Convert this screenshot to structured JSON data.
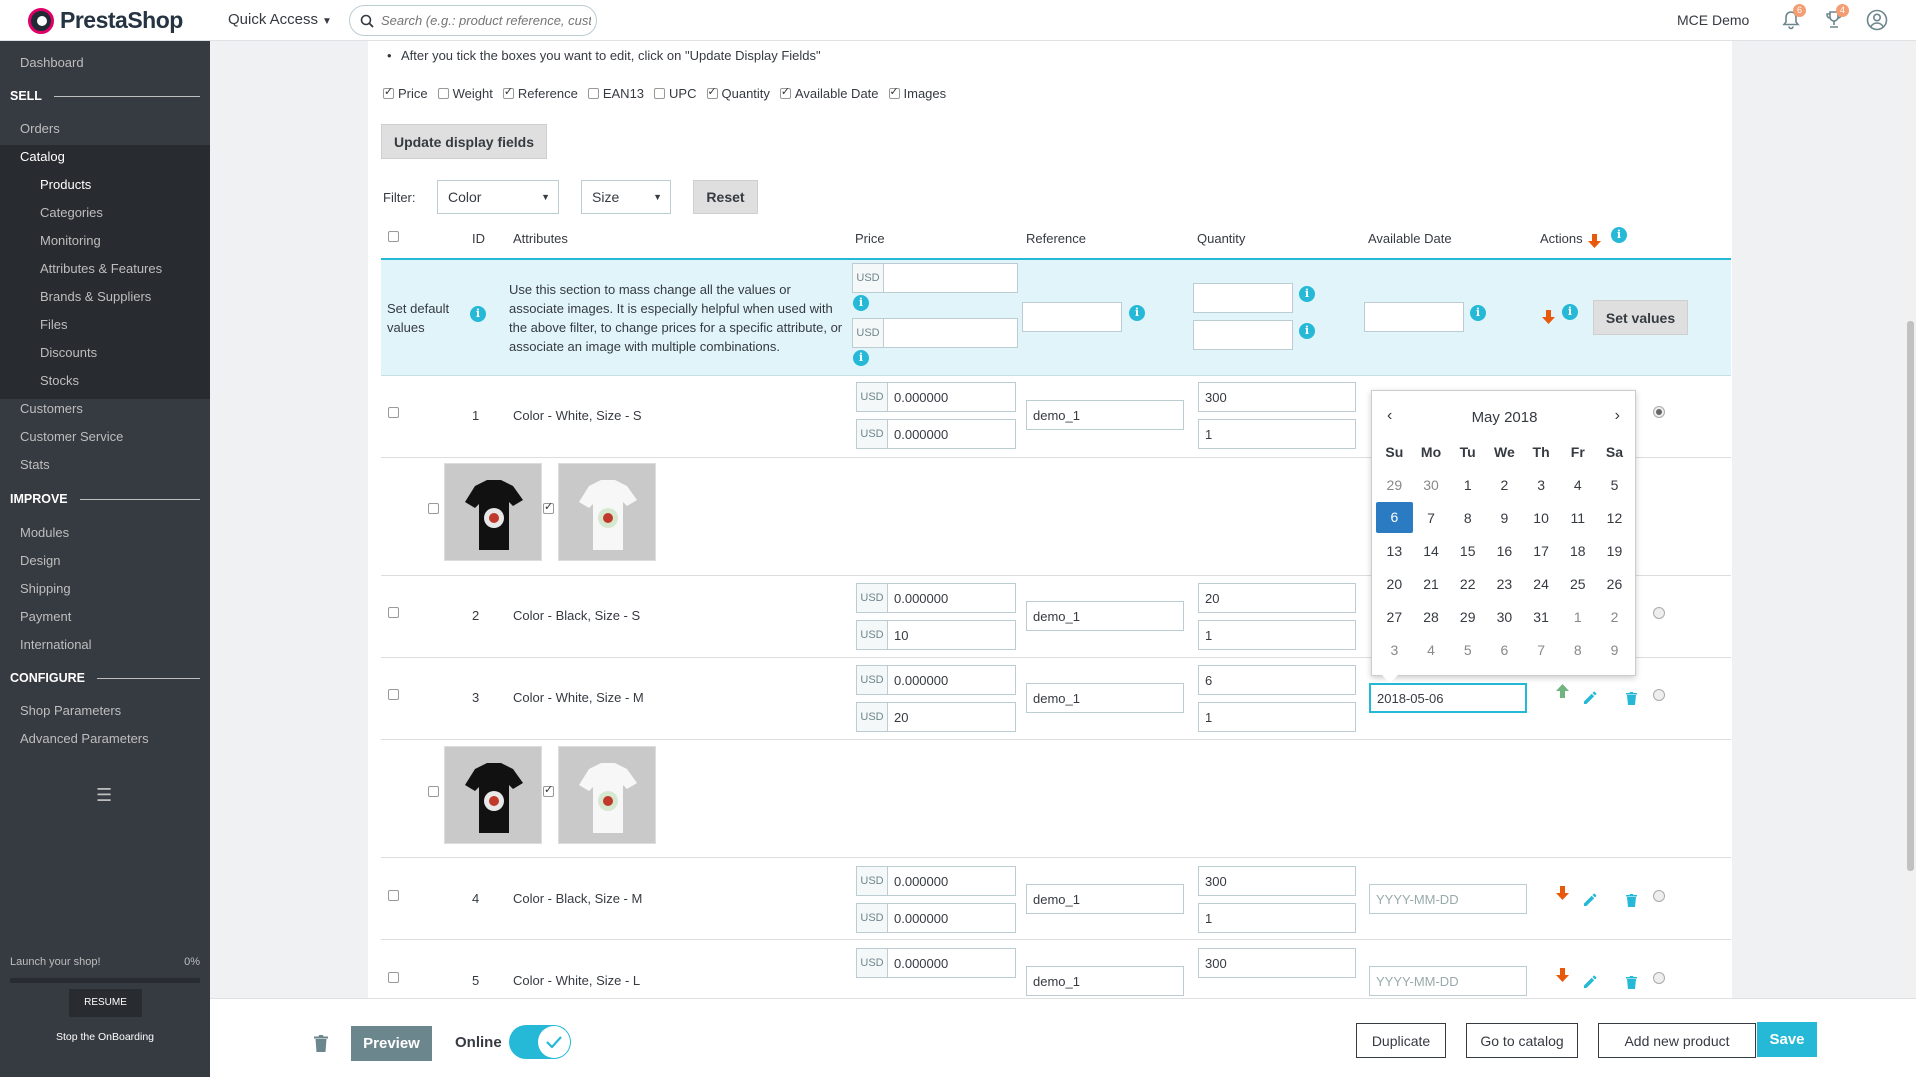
{
  "header": {
    "logo_text": "PrestaShop",
    "quick_access": "Quick Access",
    "search_placeholder": "Search (e.g.: product reference, custo",
    "shop_name": "MCE Demo",
    "notif_orders": "6",
    "notif_customers": "4"
  },
  "sidebar": {
    "dashboard": "Dashboard",
    "sell": "SELL",
    "orders": "Orders",
    "catalog": "Catalog",
    "catalog_items": [
      "Products",
      "Categories",
      "Monitoring",
      "Attributes & Features",
      "Brands & Suppliers",
      "Files",
      "Discounts",
      "Stocks"
    ],
    "customers": "Customers",
    "customer_service": "Customer Service",
    "stats": "Stats",
    "improve": "IMPROVE",
    "improve_items": [
      "Modules",
      "Design",
      "Shipping",
      "Payment",
      "International"
    ],
    "configure": "CONFIGURE",
    "configure_items": [
      "Shop Parameters",
      "Advanced Parameters"
    ],
    "launch": "Launch your shop!",
    "launch_pct": "0%",
    "resume": "RESUME",
    "stop": "Stop the OnBoarding"
  },
  "content": {
    "note": "After you tick the boxes you want to edit, click on \"Update Display Fields\"",
    "fields": [
      {
        "label": "Price",
        "checked": true
      },
      {
        "label": "Weight",
        "checked": false
      },
      {
        "label": "Reference",
        "checked": true
      },
      {
        "label": "EAN13",
        "checked": false
      },
      {
        "label": "UPC",
        "checked": false
      },
      {
        "label": "Quantity",
        "checked": true
      },
      {
        "label": "Available Date",
        "checked": true
      },
      {
        "label": "Images",
        "checked": true
      }
    ],
    "update_btn": "Update display fields",
    "filter_label": "Filter:",
    "filter_color": "Color",
    "filter_size": "Size",
    "reset_btn": "Reset",
    "columns": {
      "id": "ID",
      "attributes": "Attributes",
      "price": "Price",
      "reference": "Reference",
      "quantity": "Quantity",
      "available_date": "Available Date",
      "actions": "Actions"
    },
    "defaults": {
      "label": "Set default values",
      "help": "Use this section to mass change all the values or associate images. It is especially helpful when used with the above filter, to change prices for a specific attribute, or associate an image with multiple combinations.",
      "currency": "USD",
      "set_values": "Set values"
    },
    "rows": [
      {
        "id": "1",
        "attr": "Color - White, Size - S",
        "price1": "0.000000",
        "price2": "0.000000",
        "ref": "demo_1",
        "qty1": "300",
        "qty2": "1",
        "date": ""
      },
      {
        "id": "2",
        "attr": "Color - Black, Size - S",
        "price1": "0.000000",
        "price2": "10",
        "ref": "demo_1",
        "qty1": "20",
        "qty2": "1",
        "date": ""
      },
      {
        "id": "3",
        "attr": "Color - White, Size - M",
        "price1": "0.000000",
        "price2": "20",
        "ref": "demo_1",
        "qty1": "6",
        "qty2": "1",
        "date": "2018-05-06"
      },
      {
        "id": "4",
        "attr": "Color - Black, Size - M",
        "price1": "0.000000",
        "price2": "0.000000",
        "ref": "demo_1",
        "qty1": "300",
        "qty2": "1",
        "date": ""
      },
      {
        "id": "5",
        "attr": "Color - White, Size - L",
        "price1": "0.000000",
        "price2": "0.000000",
        "ref": "demo_1",
        "qty1": "300",
        "qty2": "1",
        "date": ""
      }
    ],
    "date_placeholder": "YYYY-MM-DD",
    "currency": "USD"
  },
  "datepicker": {
    "title": "May 2018",
    "prev": "‹",
    "next": "›",
    "days": [
      "Su",
      "Mo",
      "Tu",
      "We",
      "Th",
      "Fr",
      "Sa"
    ],
    "weeks": [
      [
        "29",
        "30",
        "1",
        "2",
        "3",
        "4",
        "5"
      ],
      [
        "6",
        "7",
        "8",
        "9",
        "10",
        "11",
        "12"
      ],
      [
        "13",
        "14",
        "15",
        "16",
        "17",
        "18",
        "19"
      ],
      [
        "20",
        "21",
        "22",
        "23",
        "24",
        "25",
        "26"
      ],
      [
        "27",
        "28",
        "29",
        "30",
        "31",
        "1",
        "2"
      ],
      [
        "3",
        "4",
        "5",
        "6",
        "7",
        "8",
        "9"
      ]
    ],
    "selected": "6"
  },
  "footer": {
    "preview": "Preview",
    "online": "Online",
    "duplicate": "Duplicate",
    "go_catalog": "Go to catalog",
    "add_new": "Add new product",
    "save": "Save"
  },
  "colors": {
    "accent": "#25b9d7",
    "sidebar": "#363a41",
    "orange_arrow": "#e8590c",
    "green_arrow": "#70b580"
  }
}
